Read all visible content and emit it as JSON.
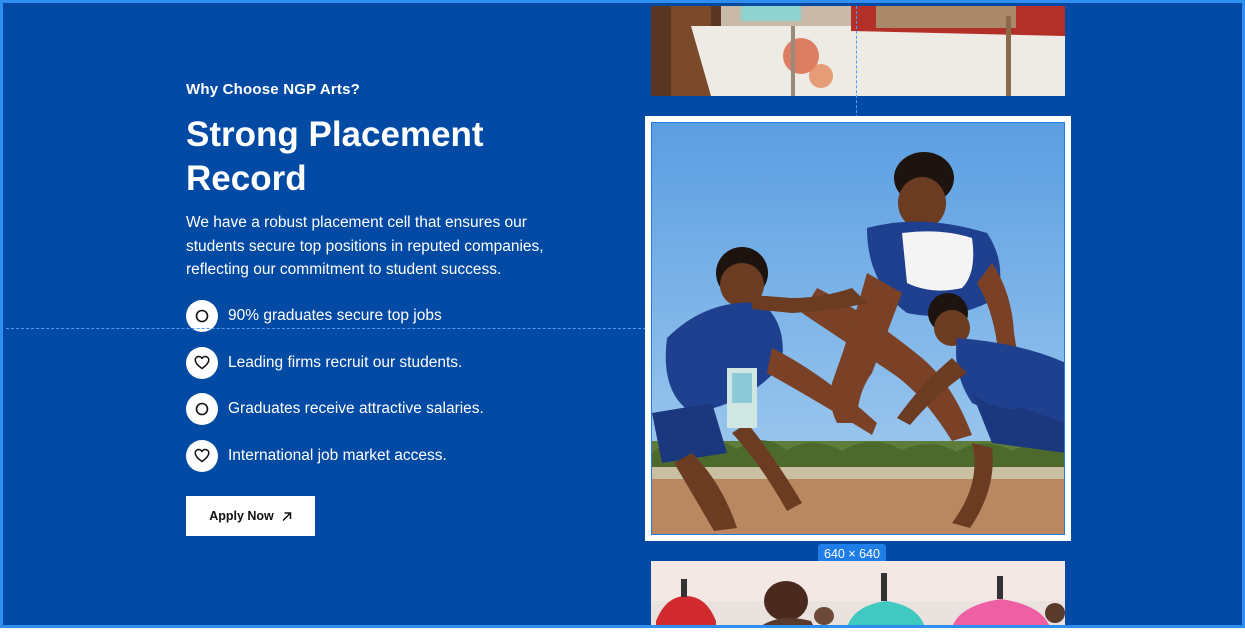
{
  "section": {
    "eyebrow": "Why Choose NGP Arts?",
    "title": "Strong Placement Record",
    "description": "We have a robust placement cell that ensures our students secure top positions in reputed companies, reflecting our commitment to student success."
  },
  "features": [
    {
      "label": "90% graduates secure top jobs",
      "icon": "circle-icon"
    },
    {
      "label": "Leading firms recruit our students.",
      "icon": "heart-icon"
    },
    {
      "label": "Graduates receive attractive salaries.",
      "icon": "circle-icon"
    },
    {
      "label": "International job market access.",
      "icon": "heart-icon"
    }
  ],
  "cta": {
    "label": "Apply Now",
    "icon": "arrow-up-right-icon"
  },
  "gallery": {
    "selected_size_label": "640 × 640",
    "images": [
      "dining-table-photo",
      "kabaddi-players-photo",
      "garment-mannequins-photo"
    ]
  },
  "colors": {
    "section_background": "#024aa3",
    "selection_outline": "#2f8ff0",
    "badge_background": "#1f7de8",
    "text": "#ffffff",
    "button_background": "#ffffff"
  }
}
